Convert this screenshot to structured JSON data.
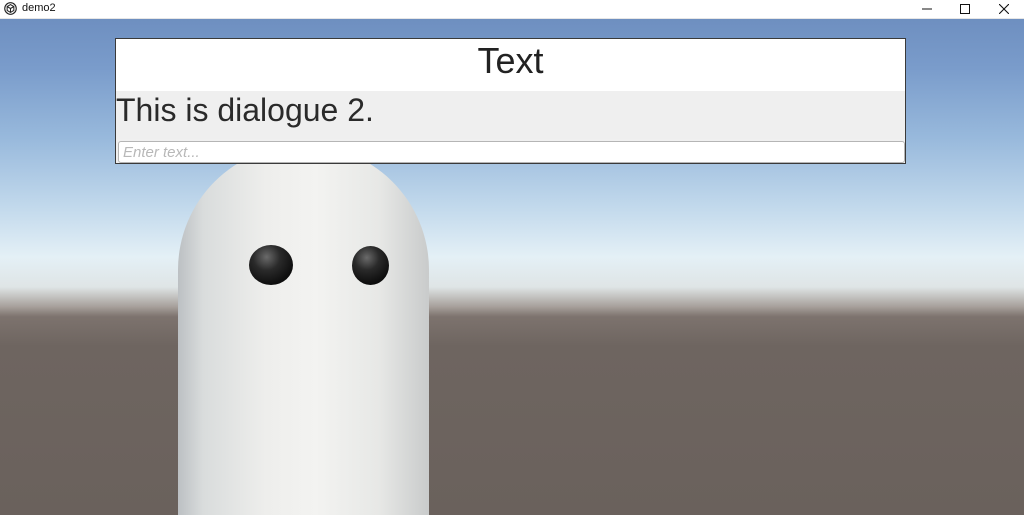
{
  "window": {
    "title": "demo2",
    "icon": "unity-icon",
    "controls": [
      "minimize-icon",
      "maximize-icon",
      "close-icon"
    ]
  },
  "dialogue_panel": {
    "title": "Text",
    "message": "This is dialogue 2.",
    "input": {
      "value": "",
      "placeholder": "Enter text..."
    }
  },
  "scene": {
    "character": "ghost",
    "sky_color": "#7a9ccb",
    "horizon_color": "#e4f0f6",
    "ground_color": "#6b615c"
  }
}
